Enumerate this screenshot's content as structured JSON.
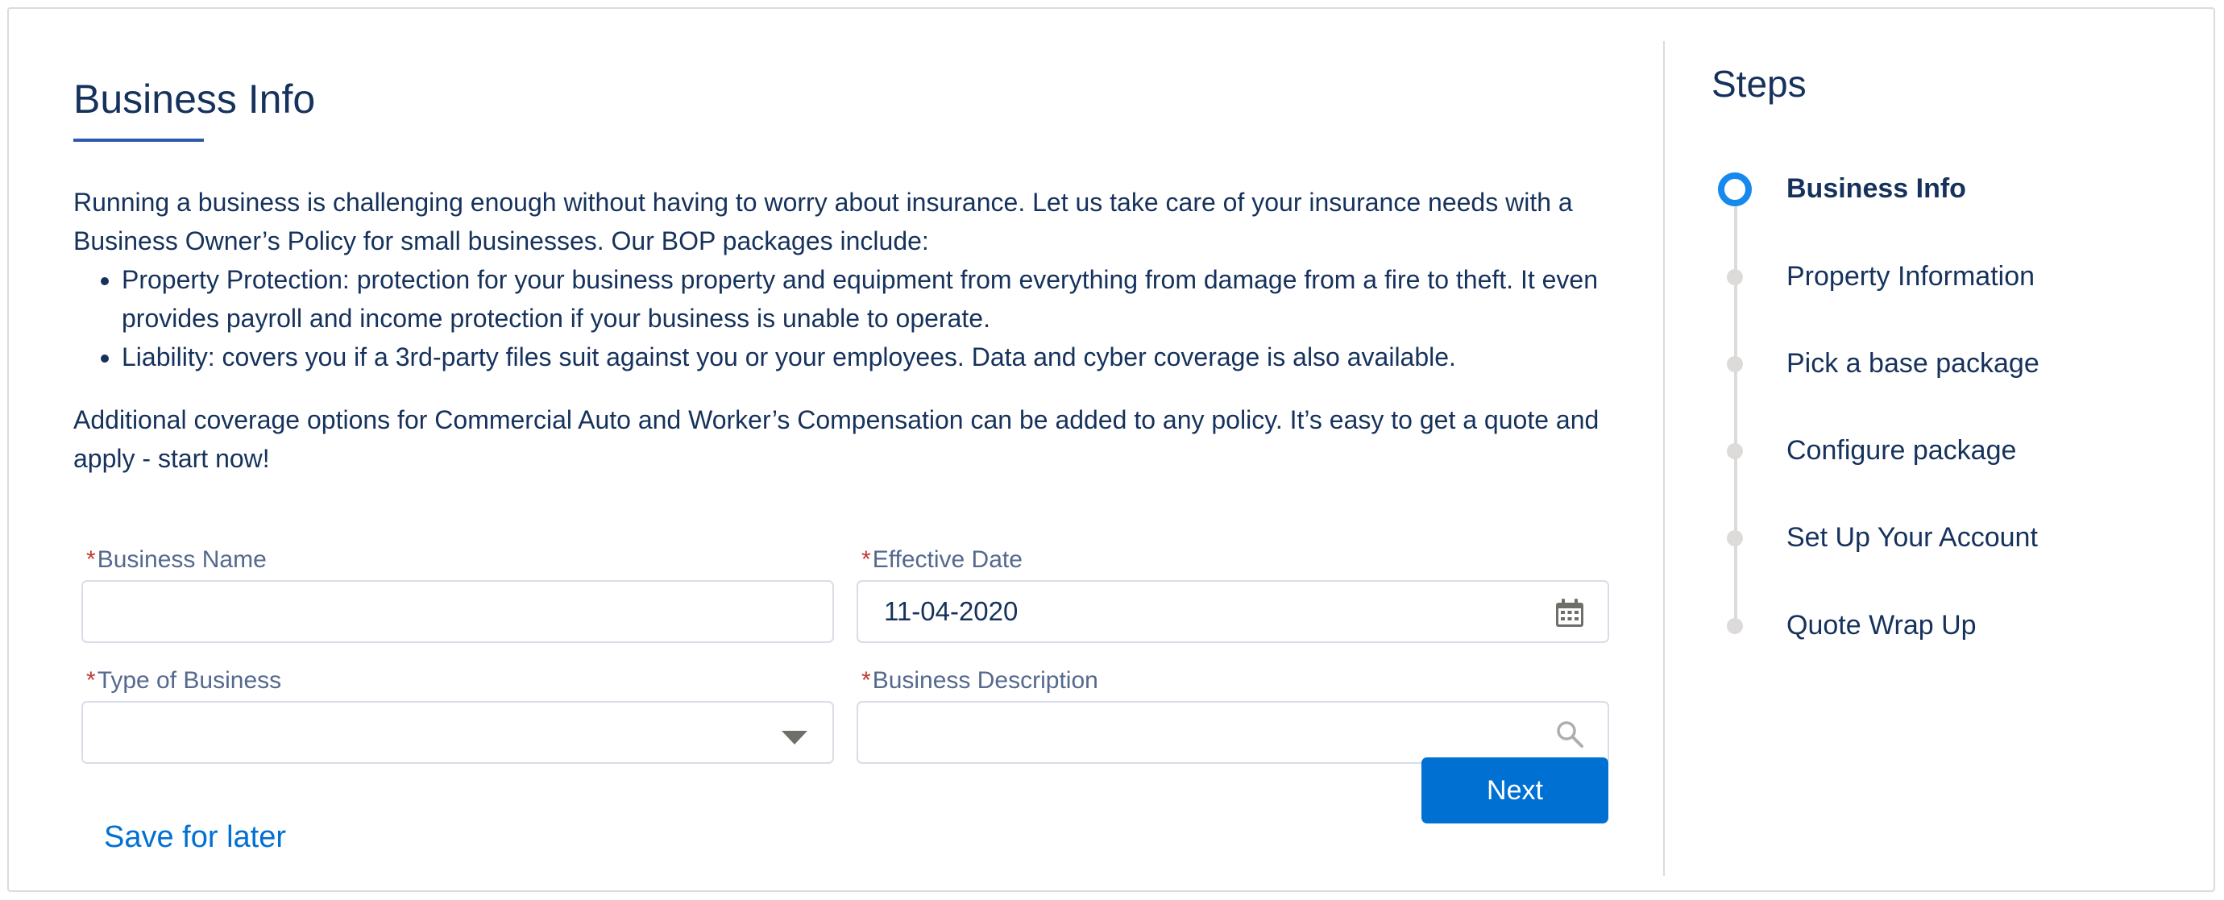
{
  "page": {
    "title": "Business Info",
    "intro": "Running a business is challenging enough without having to worry about insurance. Let us take care of your insurance needs with a Business Owner’s Policy for small businesses. Our BOP packages include:",
    "bullets": [
      "Property Protection: protection for your business property and equipment from everything from damage from a fire to theft. It even provides payroll and income protection if your business is unable to operate.",
      "Liability: covers you if a 3rd-party files suit against you or your employees. Data and cyber coverage is also available."
    ],
    "additional": "Additional coverage options for Commercial Auto and Worker’s Compensation can be added to any policy. It’s easy to get a quote and apply - start now!"
  },
  "form": {
    "required_mark": "*",
    "business_name": {
      "label": "Business Name",
      "value": ""
    },
    "effective_date": {
      "label": "Effective Date",
      "value": "11-04-2020",
      "icon": "calendar-icon"
    },
    "type_of_business": {
      "label": "Type of Business",
      "value": "",
      "icon": "chevron-down-icon"
    },
    "business_description": {
      "label": "Business Description",
      "value": "",
      "icon": "search-icon"
    }
  },
  "actions": {
    "save_later": "Save for later",
    "next": "Next"
  },
  "steps": {
    "title": "Steps",
    "items": [
      {
        "label": "Business Info",
        "active": true
      },
      {
        "label": "Property Information",
        "active": false
      },
      {
        "label": "Pick a base package",
        "active": false
      },
      {
        "label": "Configure package",
        "active": false
      },
      {
        "label": "Set Up Your Account",
        "active": false
      },
      {
        "label": "Quote Wrap Up",
        "active": false
      }
    ]
  },
  "colors": {
    "brand": "#0070d2",
    "text": "#16325c",
    "required": "#c23934",
    "step_active": "#1589ee"
  }
}
